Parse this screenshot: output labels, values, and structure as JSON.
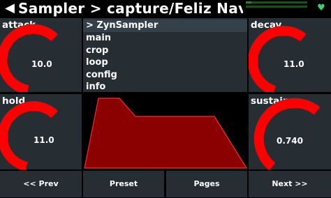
{
  "header": {
    "back_icon": "arrow-back-icon",
    "title": "Sampler > capture/Feliz Navic",
    "status_icon": "heart-icon"
  },
  "controls": {
    "attack": {
      "label": "attack",
      "value": "10.0",
      "level": 0.8
    },
    "hold": {
      "label": "hold",
      "value": "11.0",
      "level": 0.8
    },
    "decay": {
      "label": "decay",
      "value": "11.0",
      "level": 0.8
    },
    "sustain": {
      "label": "sustain",
      "value": "0.740",
      "level": 0.74
    }
  },
  "menu": {
    "items": [
      {
        "label": "> ZynSampler",
        "selected": true
      },
      {
        "label": "main"
      },
      {
        "label": "crop"
      },
      {
        "label": "loop"
      },
      {
        "label": "config"
      },
      {
        "label": "info"
      }
    ]
  },
  "buttons": {
    "prev": "<< Prev",
    "preset": "Preset",
    "pages": "Pages",
    "next": "Next >>"
  },
  "colors": {
    "accent": "#ff0000",
    "panel": "#262d33",
    "selected": "#34404a",
    "envelope_fill": "#8b0000"
  }
}
